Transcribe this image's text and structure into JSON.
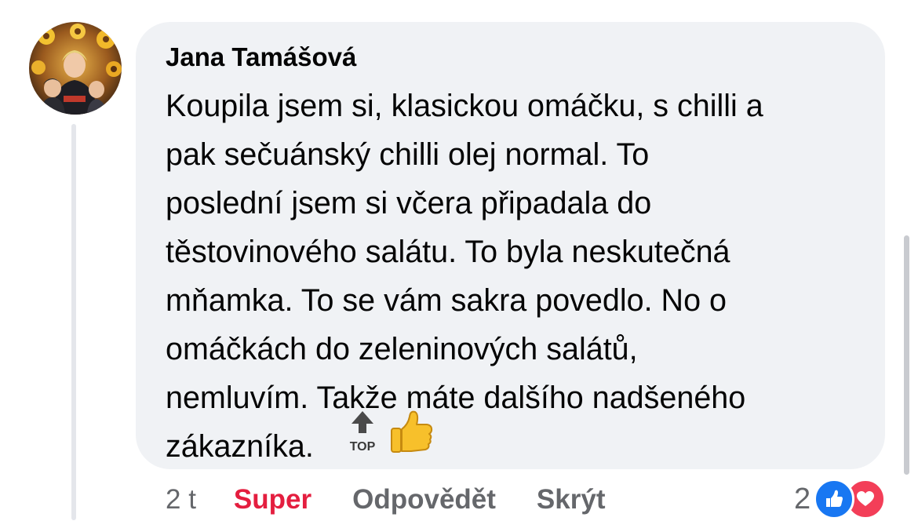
{
  "comment": {
    "author": "Jana Tamášová",
    "text": "Koupila jsem si, klasickou omáčku, s chilli a\npak sečuánský chilli olej normal. To\nposlední jsem si včera připadala do\ntěstovinového salátu. To byla neskutečná\nmňamka.  To se vám sakra povedlo. No o\nomáčkách do zeleninových salátů,\nnemluvím. Takže máte dalšího nadšeného\nzákazníka.",
    "emoji": {
      "top_label": "TOP",
      "top_icon": "top-arrow-emoji-icon",
      "thumb_icon": "thumbs-up-emoji-icon"
    }
  },
  "actions": {
    "time": "2 t",
    "like_label": "Super",
    "reply_label": "Odpovědět",
    "hide_label": "Skrýt"
  },
  "reactions": {
    "count": "2",
    "types": [
      "like",
      "love"
    ]
  },
  "colors": {
    "bubble_bg": "#f0f2f5",
    "liked_red": "#e41e3f",
    "like_blue": "#1877f2",
    "love_red": "#f33e58",
    "muted_gray": "#65676b"
  }
}
